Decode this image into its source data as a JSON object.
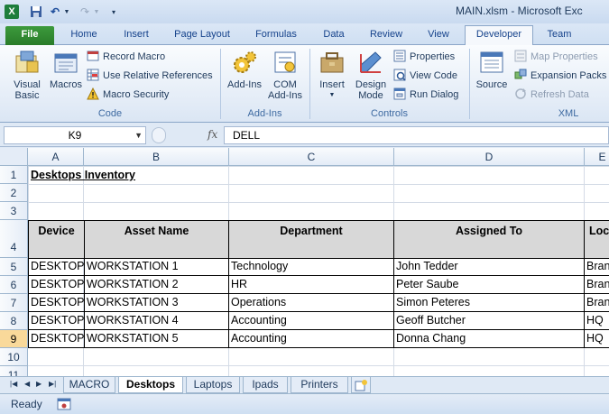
{
  "window": {
    "title": "MAIN.xlsm - Microsoft Exc"
  },
  "ribbon_tabs": [
    "File",
    "Home",
    "Insert",
    "Page Layout",
    "Formulas",
    "Data",
    "Review",
    "View",
    "Developer",
    "Team"
  ],
  "ribbon": {
    "code": {
      "label": "Code",
      "visual_basic": "Visual Basic",
      "visual_basic_l1": "Visual",
      "visual_basic_l2": "Basic",
      "macros": "Macros",
      "record_macro": "Record Macro",
      "relative_refs": "Use Relative References",
      "macro_security": "Macro Security"
    },
    "addins": {
      "label": "Add-Ins",
      "addins": "Add-Ins",
      "com_l1": "COM",
      "com_l2": "Add-Ins"
    },
    "controls": {
      "label": "Controls",
      "insert": "Insert",
      "design_l1": "Design",
      "design_l2": "Mode",
      "properties": "Properties",
      "view_code": "View Code",
      "run_dialog": "Run Dialog"
    },
    "xml": {
      "label": "XML",
      "source": "Source",
      "map_properties": "Map Properties",
      "expansion_packs": "Expansion Packs",
      "refresh_data": "Refresh Data"
    }
  },
  "formula_bar": {
    "name_box": "K9",
    "fx": "fx",
    "formula": "DELL"
  },
  "columns": [
    "A",
    "B",
    "C",
    "D",
    "E"
  ],
  "rows": [
    "1",
    "2",
    "3",
    "4",
    "5",
    "6",
    "7",
    "8",
    "9",
    "10",
    "11"
  ],
  "sheet": {
    "title": "Desktops Inventory",
    "headers": [
      "Device",
      "Asset Name",
      "Department",
      "Assigned To",
      "Loc"
    ],
    "data": [
      [
        "DESKTOP",
        "WORKSTATION 1",
        "Technology",
        "John Tedder",
        "Bran"
      ],
      [
        "DESKTOP",
        "WORKSTATION 2",
        "HR",
        "Peter Saube",
        "Bran"
      ],
      [
        "DESKTOP",
        "WORKSTATION 3",
        "Operations",
        "Simon Peteres",
        "Bran"
      ],
      [
        "DESKTOP",
        "WORKSTATION 4",
        "Accounting",
        "Geoff Butcher",
        "HQ"
      ],
      [
        "DESKTOP",
        "WORKSTATION 5",
        "Accounting",
        "Donna Chang",
        "HQ"
      ]
    ]
  },
  "sheet_tabs": [
    "MACRO",
    "Desktops",
    "Laptops",
    "Ipads",
    "Printers"
  ],
  "active_sheet": "Desktops",
  "status": {
    "ready": "Ready"
  },
  "colors": {
    "file_tab": "#2a7c2a",
    "header_fill": "#d8d8d8",
    "selected_row": "#f9d99a"
  }
}
